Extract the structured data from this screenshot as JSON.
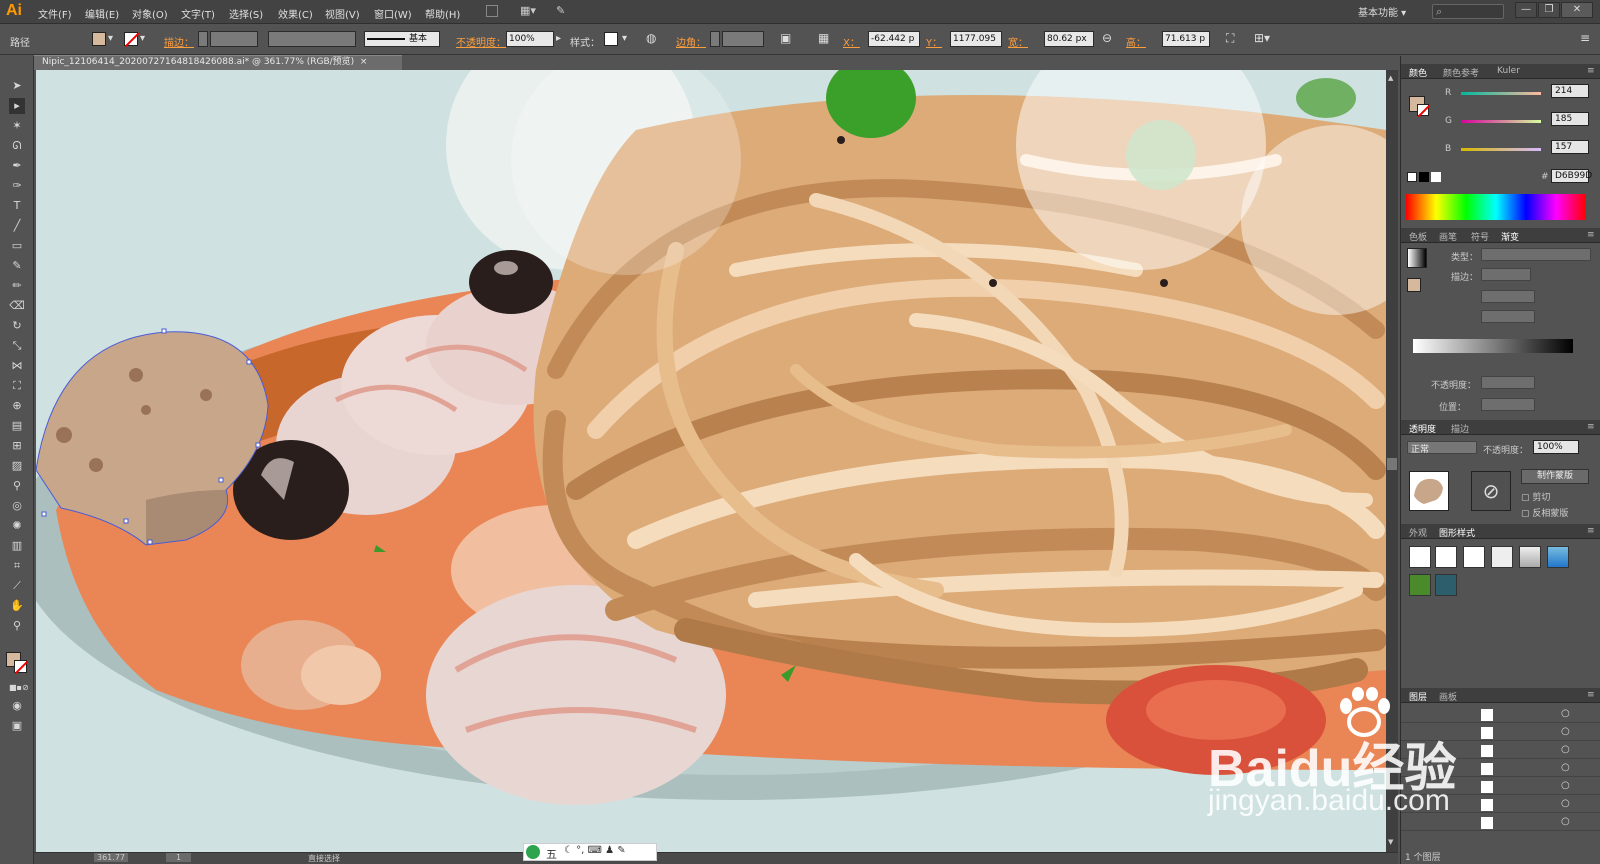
{
  "app": {
    "logo": "Ai",
    "workspace": "基本功能"
  },
  "menu": [
    "文件(F)",
    "编辑(E)",
    "对象(O)",
    "文字(T)",
    "选择(S)",
    "效果(C)",
    "视图(V)",
    "窗口(W)",
    "帮助(H)"
  ],
  "control": {
    "selection_type": "路径",
    "stroke_label": "描边：",
    "stroke_profile": "基本",
    "opacity_label": "不透明度：",
    "opacity_value": "100%",
    "style_label": "样式：",
    "corner_label": "边角：",
    "x_label": "X：",
    "x_value": "-62.442 p",
    "y_label": "Y：",
    "y_value": "1177.095",
    "w_label": "宽：",
    "w_value": "80.62 px",
    "h_label": "高：",
    "h_value": "71.613 p"
  },
  "document": {
    "tab": "Nipic_12106414_20200727164818426088.ai* @ 361.77% (RGB/预览)",
    "close": "×"
  },
  "status": {
    "zoom": "361.77",
    "artboard": "1",
    "tool": "直接选择"
  },
  "color_panel": {
    "tabs": [
      "颜色",
      "颜色参考",
      "Kuler"
    ],
    "r_label": "R",
    "r": "214",
    "g_label": "G",
    "g": "185",
    "b_label": "B",
    "b": "157",
    "hex_label": "#",
    "hex": "D6B99D",
    "fill_color": "#D6B99D"
  },
  "gradient_panel": {
    "tabs": [
      "色板",
      "画笔",
      "符号",
      "渐变"
    ],
    "type_label": "类型：",
    "stroke_label": "描边：",
    "opacity_label": "不透明度：",
    "position_label": "位置："
  },
  "transparency_panel": {
    "tabs": [
      "透明度",
      "描边"
    ],
    "mode": "正常",
    "opacity_label": "不透明度：",
    "opacity": "100%",
    "make_mask": "制作蒙版",
    "clip": "剪切",
    "invert": "反相蒙版"
  },
  "graphic_styles": {
    "tabs": [
      "外观",
      "图形样式"
    ]
  },
  "layers_panel": {
    "tabs": [
      "图层",
      "画板"
    ],
    "footer": "1 个图层"
  },
  "watermark": {
    "brand": "Baidu经验",
    "url": "jingyan.baidu.com"
  },
  "ime": {
    "label": "五"
  }
}
